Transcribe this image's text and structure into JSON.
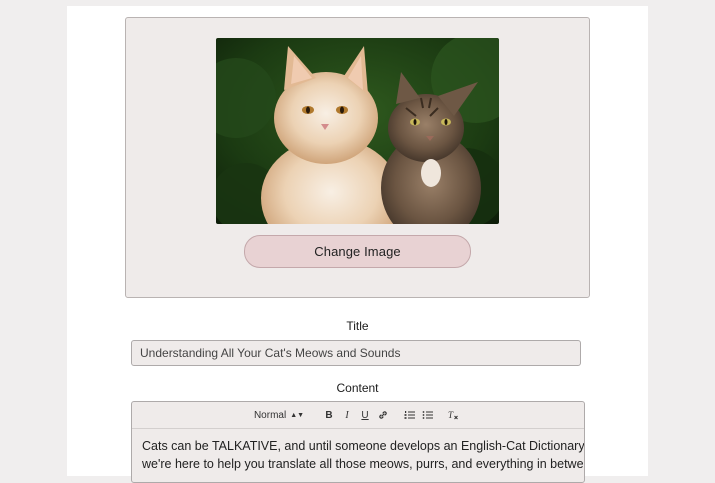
{
  "image_section": {
    "change_image_label": "Change Image"
  },
  "title_field": {
    "label": "Title",
    "value": "Understanding All Your Cat's Meows and Sounds"
  },
  "content_field": {
    "label": "Content",
    "toolbar": {
      "format_select": "Normal",
      "bold": "B",
      "italic": "I",
      "underline": "U"
    },
    "lines": [
      "Cats can be TALKATIVE, and until someone develops an English-Cat Dictionary,",
      "we're here to help you translate all those meows, purrs, and everything in between."
    ]
  },
  "icons": {
    "link": "link-icon",
    "ordered_list": "ordered-list-icon",
    "bullet_list": "bullet-list-icon",
    "clear_format": "clear-format-icon"
  },
  "colors": {
    "page_bg": "#f0eeee",
    "card_bg": "#efebea",
    "button_bg": "#e8d2d3"
  }
}
